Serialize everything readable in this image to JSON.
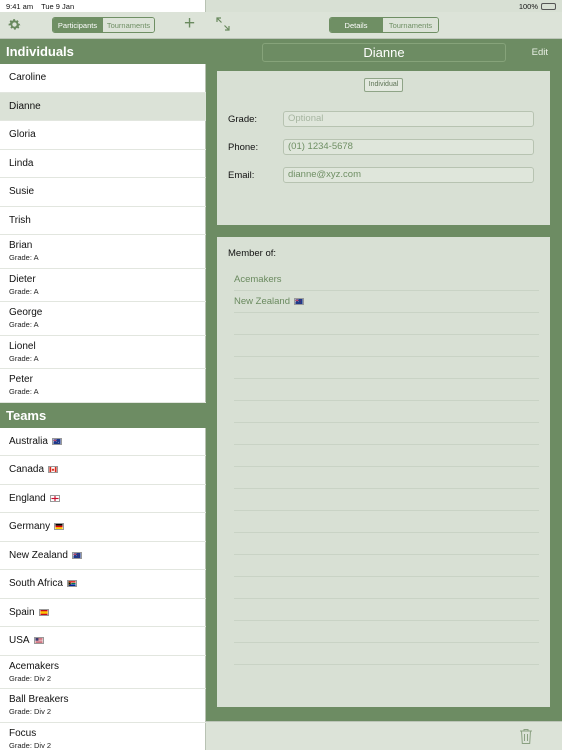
{
  "status": {
    "time": "9:41 am",
    "date": "Tue 9 Jan",
    "battery": "100%",
    "battery_level": 1.0
  },
  "left_toolbar": {
    "tabs": [
      "Participants",
      "Tournaments"
    ],
    "active_tab": 0
  },
  "individuals_header": "Individuals",
  "individuals": [
    {
      "name": "Caroline",
      "sub": ""
    },
    {
      "name": "Dianne",
      "sub": "",
      "selected": true
    },
    {
      "name": "Gloria",
      "sub": ""
    },
    {
      "name": "Linda",
      "sub": ""
    },
    {
      "name": "Susie",
      "sub": ""
    },
    {
      "name": "Trish",
      "sub": ""
    },
    {
      "name": "Brian",
      "sub": "Grade: A"
    },
    {
      "name": "Dieter",
      "sub": "Grade: A"
    },
    {
      "name": "George",
      "sub": "Grade: A"
    },
    {
      "name": "Lionel",
      "sub": "Grade: A"
    },
    {
      "name": "Peter",
      "sub": "Grade: A"
    }
  ],
  "teams_header": "Teams",
  "teams": [
    {
      "name": "Australia",
      "flag": "au",
      "sub": ""
    },
    {
      "name": "Canada",
      "flag": "ca",
      "sub": ""
    },
    {
      "name": "England",
      "flag": "en",
      "sub": ""
    },
    {
      "name": "Germany",
      "flag": "de",
      "sub": ""
    },
    {
      "name": "New Zealand",
      "flag": "nz",
      "sub": ""
    },
    {
      "name": "South Africa",
      "flag": "za",
      "sub": ""
    },
    {
      "name": "Spain",
      "flag": "es",
      "sub": ""
    },
    {
      "name": "USA",
      "flag": "us",
      "sub": ""
    },
    {
      "name": "Acemakers",
      "flag": "",
      "sub": "Grade: Div 2"
    },
    {
      "name": "Ball Breakers",
      "flag": "",
      "sub": "Grade: Div 2"
    },
    {
      "name": "Focus",
      "flag": "",
      "sub": "Grade: Div 2"
    }
  ],
  "right_toolbar": {
    "tabs": [
      "Details",
      "Tournaments"
    ],
    "active_tab": 0
  },
  "detail": {
    "name": "Dianne",
    "edit_label": "Edit",
    "type_badge": "Individual",
    "grade_label": "Grade:",
    "grade_placeholder": "Optional",
    "phone_label": "Phone:",
    "phone_value": "(01) 1234-5678",
    "email_label": "Email:",
    "email_value": "dianne@xyz.com",
    "member_of_label": "Member of:",
    "member_of": [
      {
        "name": "Acemakers",
        "flag": ""
      },
      {
        "name": "New Zealand",
        "flag": "nz"
      }
    ],
    "empty_member_rows": 16
  },
  "colors": {
    "accent": "#6d8c63",
    "panel": "#d8e0d4",
    "toolbar": "#dce3d8"
  }
}
